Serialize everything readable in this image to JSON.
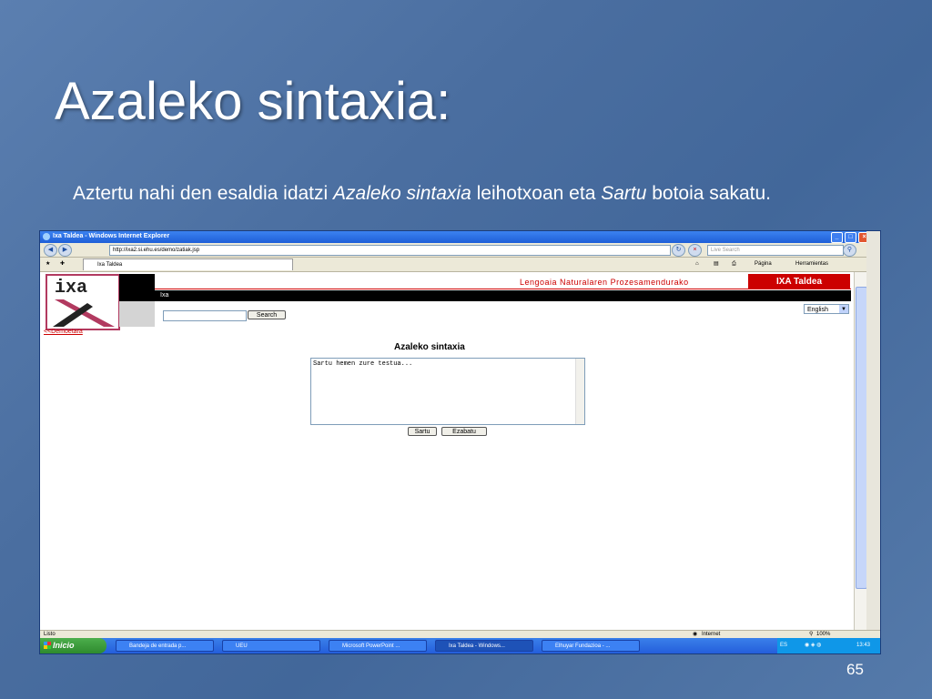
{
  "slide": {
    "title": "Azaleko sintaxia:",
    "body_1": "Aztertu nahi den esaldia idatzi ",
    "body_em_1": "Azaleko sintaxia",
    "body_2": " leihotxoan eta ",
    "body_em_2": "Sartu",
    "body_3": " botoia sakatu.",
    "page_number": "65"
  },
  "browser": {
    "window_title": "Ixa Taldea - Windows Internet Explorer",
    "url": "http://ixa2.si.ehu.es/demo/zatiak.jsp",
    "live_search_placeholder": "Live Search",
    "tab_label": "Ixa Taldea",
    "toolbar_page": "Página",
    "toolbar_tools": "Herramientas",
    "status_left": "Listo",
    "status_zone": "Internet",
    "status_zoom": "100%"
  },
  "page": {
    "logo_text": "ixa",
    "demo_link": "<<Demoetara",
    "header_text": "Lengoaia Naturalaren Prozesamendurako",
    "header_box": "IXA Taldea",
    "nav_label": "Ixa",
    "search_button": "Search",
    "language_selected": "English",
    "tool_title": "Azaleko sintaxia",
    "textarea_text": "Sartu hemen zure testua...",
    "submit_button": "Sartu",
    "clear_button": "Ezabatu"
  },
  "taskbar": {
    "start_label": "Inicio",
    "tasks": [
      "Bandeja de entrada p...",
      "UEU",
      "Microsoft PowerPoint ...",
      "Ixa Taldea - Windows...",
      "Elhuyar Fundazioa - ..."
    ],
    "language": "ES",
    "clock": "13:43"
  },
  "colors": {
    "brand_red": "#cc0000",
    "slide_bg": "#4a6ea0",
    "xp_blue": "#245edb"
  }
}
